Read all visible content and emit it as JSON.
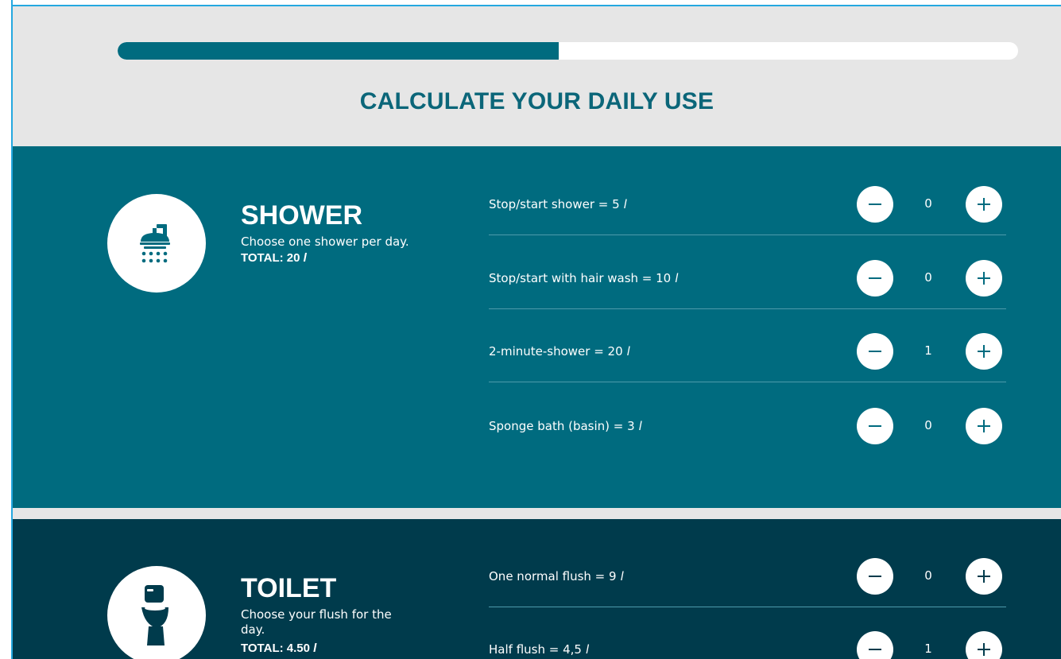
{
  "progress": {
    "percent": 49
  },
  "page_title": "CALCULATE YOUR DAILY USE",
  "colors": {
    "accent": "#006b7f",
    "dark": "#003b4c",
    "header_bg": "#e6e6e6",
    "title": "#0b6679"
  },
  "shower": {
    "title": "SHOWER",
    "description": "Choose one shower per day.",
    "total_label": "TOTAL: 20",
    "unit": "l",
    "icon": "shower-icon",
    "options": [
      {
        "label": "Stop/start shower = 5",
        "unit": "l",
        "count": "0"
      },
      {
        "label": "Stop/start with hair wash = 10",
        "unit": "l",
        "count": "0"
      },
      {
        "label": "2-minute-shower = 20",
        "unit": "l",
        "count": "1"
      },
      {
        "label": "Sponge bath (basin) = 3",
        "unit": "l",
        "count": "0"
      }
    ]
  },
  "toilet": {
    "title": "TOILET",
    "description_line1": "Choose your flush for the",
    "description_line2": "day.",
    "total_label": "TOTAL: 4.50",
    "unit": "l",
    "icon": "toilet-icon",
    "options": [
      {
        "label": "One normal flush = 9",
        "unit": "l",
        "count": "0"
      },
      {
        "label": "Half flush = 4,5",
        "unit": "l",
        "count": "1"
      }
    ]
  },
  "buttons": {
    "minus_icon": "minus-icon",
    "plus_icon": "plus-icon"
  }
}
